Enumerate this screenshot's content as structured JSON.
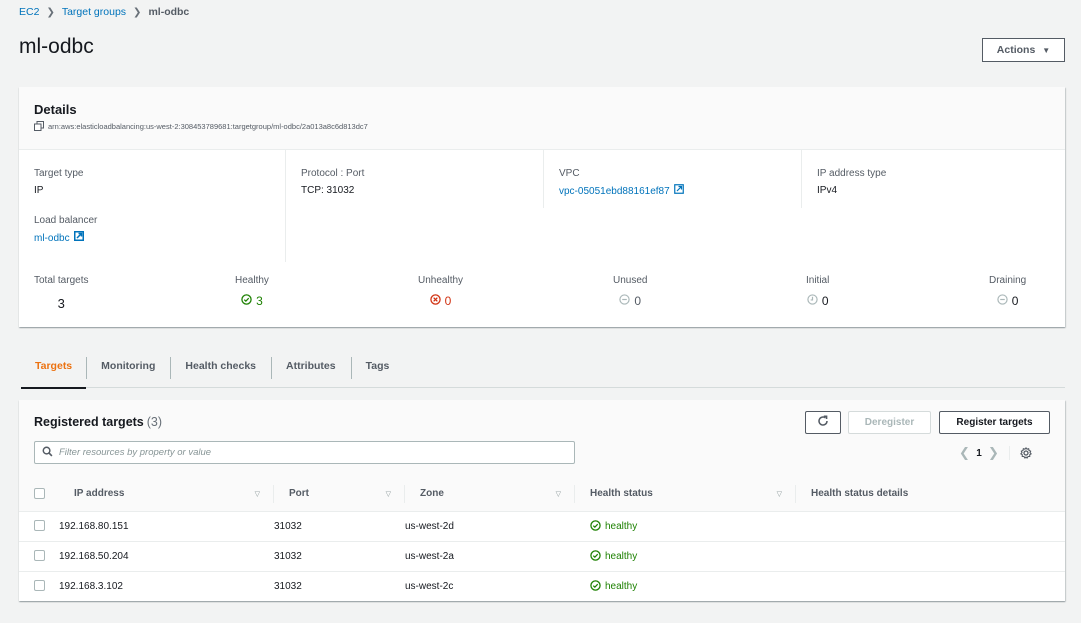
{
  "breadcrumb": {
    "items": [
      "EC2",
      "Target groups"
    ],
    "current": "ml-odbc"
  },
  "page": {
    "title": "ml-odbc",
    "actions_label": "Actions"
  },
  "details": {
    "title": "Details",
    "arn": "arn:aws:elasticloadbalancing:us-west-2:308453789681:targetgroup/ml-odbc/2a013a8c6d813dc7",
    "target_type_label": "Target type",
    "target_type_value": "IP",
    "protocol_label": "Protocol : Port",
    "protocol_value": "TCP: 31032",
    "vpc_label": "VPC",
    "vpc_value": "vpc-05051ebd88161ef87",
    "ip_type_label": "IP address type",
    "ip_type_value": "IPv4",
    "lb_label": "Load balancer",
    "lb_value": "ml-odbc",
    "counts": {
      "total_label": "Total targets",
      "total": "3",
      "healthy_label": "Healthy",
      "healthy": "3",
      "unhealthy_label": "Unhealthy",
      "unhealthy": "0",
      "unused_label": "Unused",
      "unused": "0",
      "initial_label": "Initial",
      "initial": "0",
      "draining_label": "Draining",
      "draining": "0"
    }
  },
  "tabs": [
    {
      "label": "Targets",
      "active": true
    },
    {
      "label": "Monitoring"
    },
    {
      "label": "Health checks"
    },
    {
      "label": "Attributes"
    },
    {
      "label": "Tags"
    }
  ],
  "targets": {
    "title": "Registered targets",
    "count": "(3)",
    "filter_placeholder": "Filter resources by property or value",
    "filter_value": "",
    "deregister_label": "Deregister",
    "register_label": "Register targets",
    "page": "1",
    "columns": [
      "IP address",
      "Port",
      "Zone",
      "Health status",
      "Health status details"
    ],
    "rows": [
      {
        "ip": "192.168.80.151",
        "port": "31032",
        "zone": "us-west-2d",
        "health": "healthy",
        "details": ""
      },
      {
        "ip": "192.168.50.204",
        "port": "31032",
        "zone": "us-west-2a",
        "health": "healthy",
        "details": ""
      },
      {
        "ip": "192.168.3.102",
        "port": "31032",
        "zone": "us-west-2c",
        "health": "healthy",
        "details": ""
      }
    ]
  },
  "colors": {
    "link": "#0073bb",
    "active_tab": "#ec7211",
    "healthy": "#1d8102",
    "unhealthy": "#d13212",
    "neutral": "#879596"
  }
}
